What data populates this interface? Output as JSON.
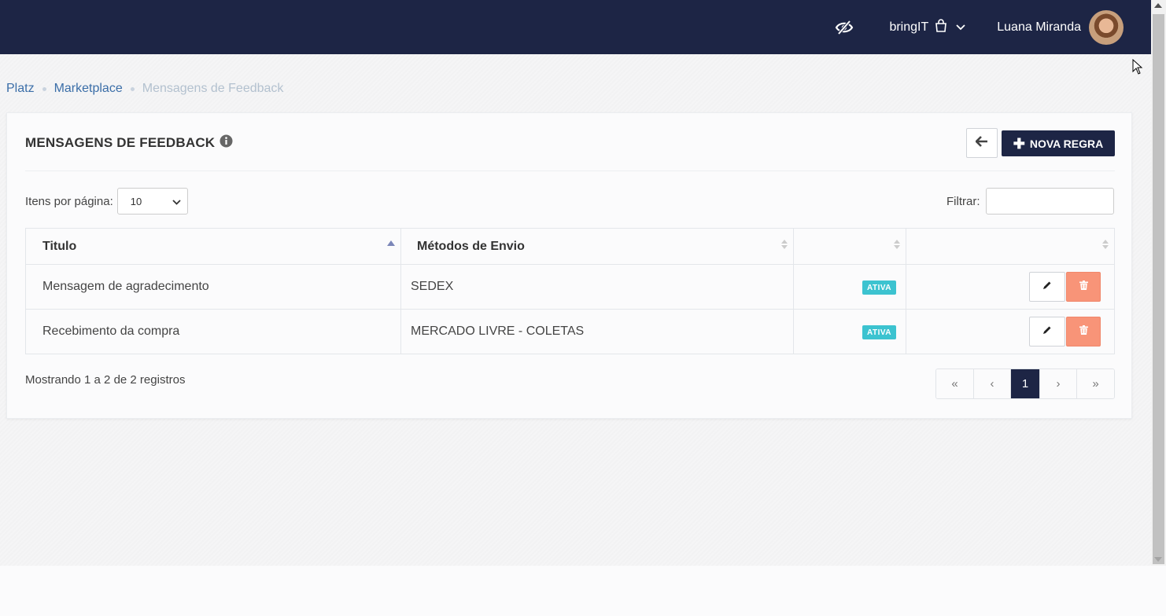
{
  "header": {
    "company": "bringIT",
    "user_name": "Luana Miranda"
  },
  "breadcrumb": {
    "items": [
      "Platz",
      "Marketplace"
    ],
    "current": "Mensagens de Feedback"
  },
  "card": {
    "title": "MENSAGENS DE FEEDBACK",
    "new_button_label": "NOVA REGRA"
  },
  "controls": {
    "per_page_label": "Itens por página:",
    "per_page_value": "10",
    "filter_label": "Filtrar:",
    "filter_value": ""
  },
  "table": {
    "columns": [
      "Titulo",
      "Métodos de Envio",
      "",
      ""
    ],
    "sorted_column": "Titulo",
    "rows": [
      {
        "title": "Mensagem de agradecimento",
        "method": "SEDEX",
        "status": "ATIVA"
      },
      {
        "title": "Recebimento da compra",
        "method": "MERCADO LIVRE - COLETAS",
        "status": "ATIVA"
      }
    ]
  },
  "footer": {
    "info": "Mostrando 1 a 2 de 2 registros",
    "pagination": [
      "«",
      "‹",
      "1",
      "›",
      "»"
    ],
    "active_page": "1"
  },
  "colors": {
    "navy": "#1d2545",
    "badge": "#3cc3d0",
    "delete": "#f89478",
    "link": "#3b6ea8"
  }
}
